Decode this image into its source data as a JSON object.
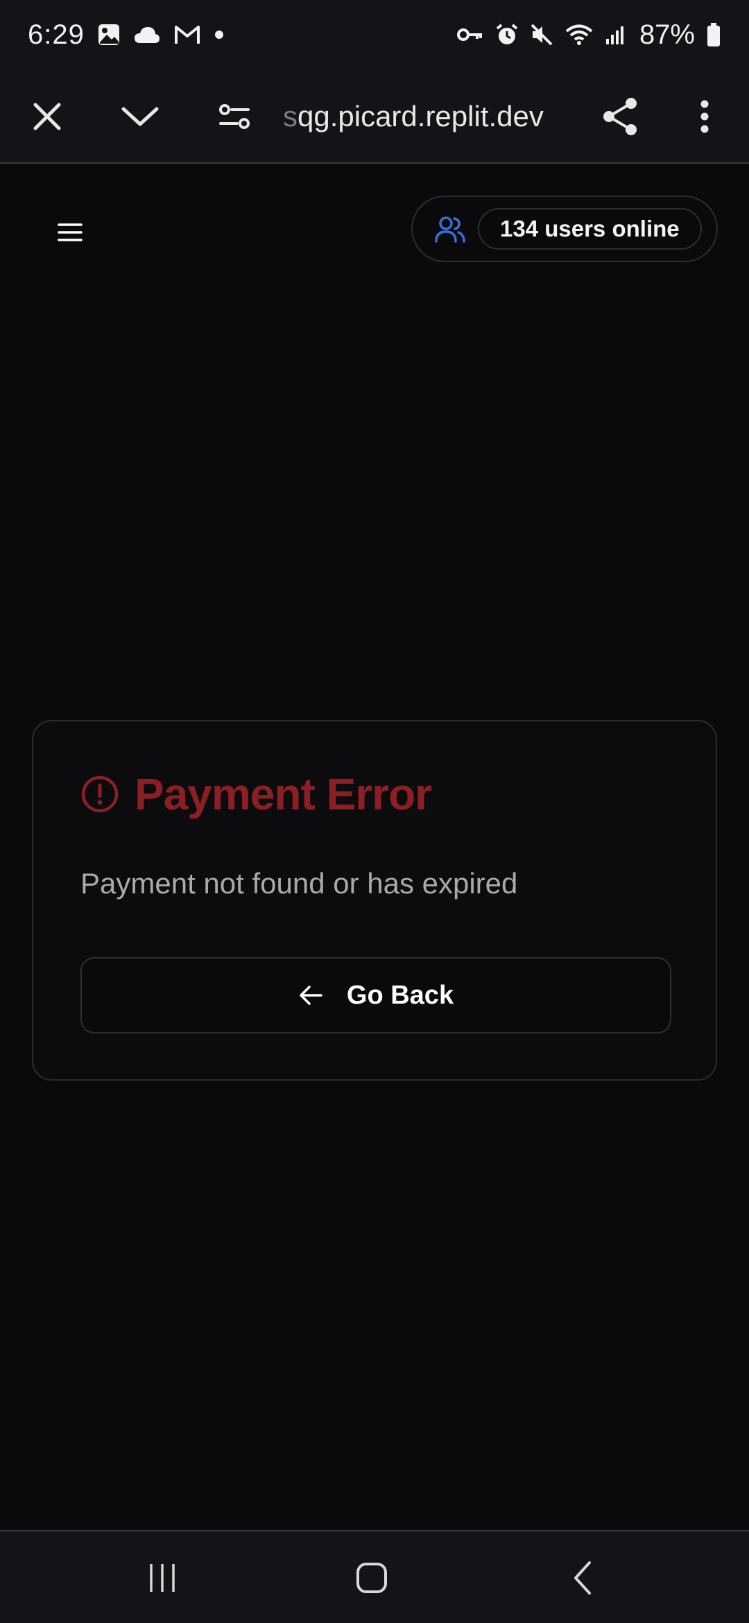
{
  "status_bar": {
    "time": "6:29",
    "battery": "87%",
    "left_icons": [
      "gallery-icon",
      "cloud-icon",
      "gmail-icon",
      "dot-icon"
    ],
    "right_icons": [
      "vpn-key-icon",
      "alarm-icon",
      "mute-icon",
      "wifi-icon",
      "signal-icon",
      "battery-icon"
    ]
  },
  "browser": {
    "url_faded": "s",
    "url": "qg.picard.replit.dev"
  },
  "header": {
    "online_count_text": "134 users online"
  },
  "error_card": {
    "title": "Payment Error",
    "message": "Payment not found or has expired",
    "back_label": "Go Back"
  },
  "colors": {
    "background": "#0a0a0c",
    "error_red": "#8b1f24",
    "accent_blue": "#3b6fd8",
    "bar_bg": "#131418"
  }
}
